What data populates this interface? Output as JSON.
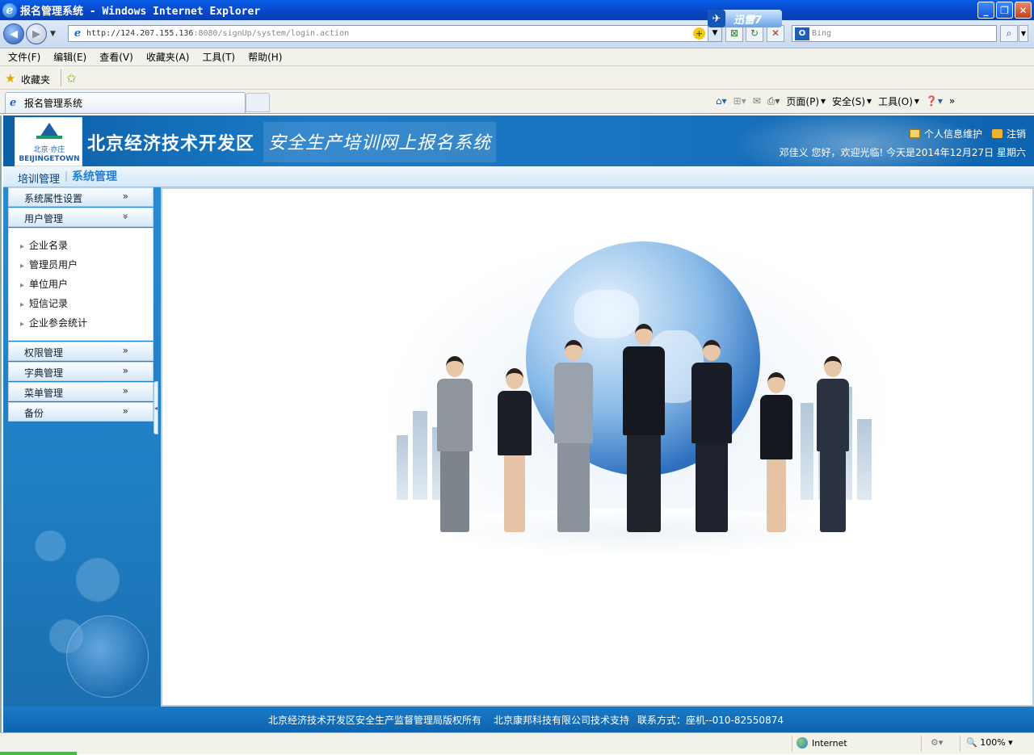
{
  "browser": {
    "window_title": "报名管理系统 - Windows Internet Explorer",
    "xunlei_label": "迅雷7",
    "url_host": "http://124.207.155.136",
    "url_rest": ":8080/signUp/system/login.action",
    "search_placeholder": "Bing",
    "menu": [
      "文件(F)",
      "编辑(E)",
      "查看(V)",
      "收藏夹(A)",
      "工具(T)",
      "帮助(H)"
    ],
    "favorites_label": "收藏夹",
    "tab_title": "报名管理系统",
    "command_bar": [
      "页面(P)",
      "安全(S)",
      "工具(O)"
    ],
    "status_zone": "Internet",
    "zoom": "100%"
  },
  "header": {
    "logo_cn": "北京·亦庄",
    "logo_en": "BEIJINGETOWN",
    "title_main": "北京经济技术开发区",
    "title_sub": "安全生产培训网上报名系统",
    "link_profile": "个人信息维护",
    "link_logout": "注销",
    "welcome": "邓佳义 您好，欢迎光临! 今天是2014年12月27日 星期六"
  },
  "topnav": {
    "item1": "培训管理",
    "item2": "系统管理"
  },
  "sidebar": {
    "groups": [
      {
        "label": "系统属性设置"
      },
      {
        "label": "用户管理"
      },
      {
        "label": "权限管理"
      },
      {
        "label": "字典管理"
      },
      {
        "label": "菜单管理"
      },
      {
        "label": "备份"
      }
    ],
    "user_items": [
      "企业名录",
      "管理员用户",
      "单位用户",
      "短信记录",
      "企业参会统计"
    ]
  },
  "footer": {
    "copyright": "北京经济技术开发区安全生产监督管理局版权所有",
    "support": "北京康邦科技有限公司技术支持",
    "contact": "联系方式：座机--010-82550874"
  },
  "colors": {
    "banner_blue": "#1b7ac6",
    "active_nav": "#1d80d6",
    "sidebar_blue": "#1f7dc2"
  }
}
